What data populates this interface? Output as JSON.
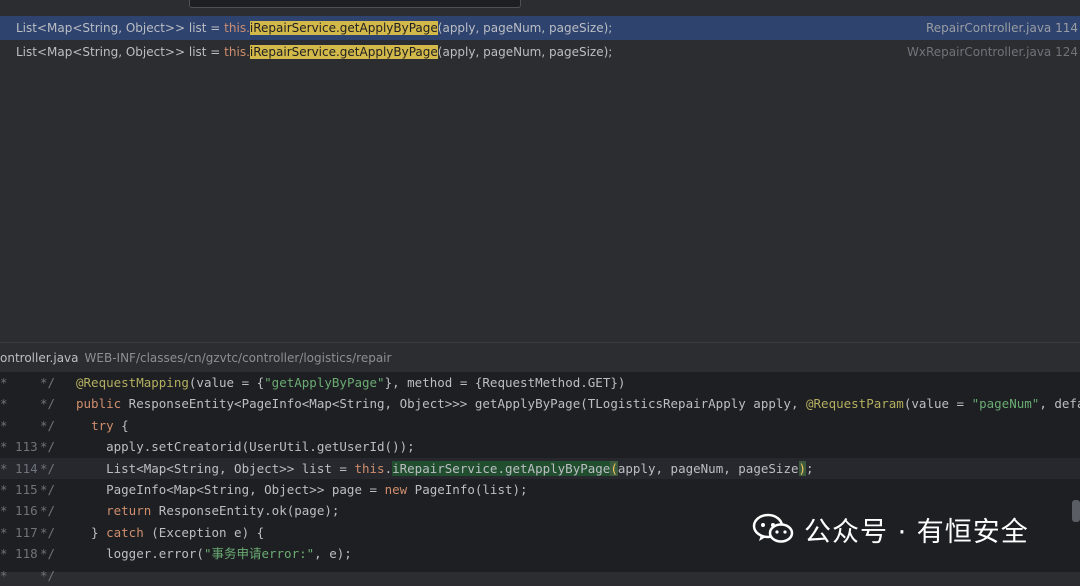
{
  "top": {
    "tabs": [
      "",
      "",
      ""
    ],
    "search_value": ""
  },
  "results": [
    {
      "prefix": "List<Map<String, Object>> list = ",
      "this": "this.",
      "match": "iRepairService.getApplyByPage",
      "suffix": "(apply, pageNum, pageSize);",
      "location": "RepairController.java 114",
      "selected": true
    },
    {
      "prefix": "List<Map<String, Object>> list = ",
      "this": "this.",
      "match": "iRepairService.getApplyByPage",
      "suffix": "(apply, pageNum, pageSize);",
      "location": "WxRepairController.java 124",
      "selected": false
    }
  ],
  "path": {
    "file": "ontroller.java",
    "dir": "WEB-INF/classes/cn/gzvtc/controller/logistics/repair"
  },
  "code": [
    {
      "ln": "*",
      "cm": "*/",
      "parts": [
        [
          "ann",
          "@RequestMapping"
        ],
        [
          "",
          "(value = {"
        ],
        [
          "str",
          "\"getApplyByPage\""
        ],
        [
          "",
          "}, method = {RequestMethod.GET})"
        ]
      ]
    },
    {
      "ln": "*",
      "cm": "*/",
      "parts": [
        [
          "kw",
          "public"
        ],
        [
          "",
          " ResponseEntity<PageInfo<Map<String, Object>>> getApplyByPage(TLogisticsRepairApply apply, "
        ],
        [
          "ann",
          "@RequestParam"
        ],
        [
          "",
          "(value = "
        ],
        [
          "str",
          "\"pageNum\""
        ],
        [
          "",
          ", defaultV"
        ]
      ]
    },
    {
      "ln": "*",
      "cm": "*/",
      "parts": [
        [
          "",
          "  "
        ],
        [
          "kw",
          "try"
        ],
        [
          "",
          " {"
        ]
      ]
    },
    {
      "ln": "* 113",
      "cm": "*/",
      "parts": [
        [
          "",
          "    apply.setCreatorid(UserUtil.getUserId());"
        ]
      ]
    },
    {
      "ln": "* 114",
      "cm": "*/",
      "current": true,
      "parts": [
        [
          "",
          "    List<Map<String, Object>> list = "
        ],
        [
          "kw",
          "this"
        ],
        [
          "",
          "."
        ],
        [
          "usage",
          "iRepairService.getApplyByPage"
        ],
        [
          "brace",
          "("
        ],
        [
          "",
          "apply, pageNum, pageSize"
        ],
        [
          "brace",
          ")"
        ],
        [
          "",
          ";"
        ]
      ]
    },
    {
      "ln": "* 115",
      "cm": "*/",
      "parts": [
        [
          "",
          "    PageInfo<Map<String, Object>> page = "
        ],
        [
          "kw",
          "new"
        ],
        [
          "",
          " PageInfo(list);"
        ]
      ]
    },
    {
      "ln": "* 116",
      "cm": "*/",
      "parts": [
        [
          "",
          "    "
        ],
        [
          "kw",
          "return"
        ],
        [
          "",
          " ResponseEntity.ok(page);"
        ]
      ]
    },
    {
      "ln": "* 117",
      "cm": "*/",
      "parts": [
        [
          "",
          "  } "
        ],
        [
          "kw",
          "catch"
        ],
        [
          "",
          " (Exception e) {"
        ]
      ]
    },
    {
      "ln": "* 118",
      "cm": "*/",
      "parts": [
        [
          "",
          "    logger.error("
        ],
        [
          "str",
          "\"事务申请error:\""
        ],
        [
          "",
          ", e);"
        ]
      ]
    },
    {
      "ln": "*",
      "cm": "*/",
      "parts": [
        [
          "",
          ""
        ]
      ]
    }
  ],
  "watermark": {
    "text": "公众号 · 有恒安全",
    "icon": "wechat-icon"
  }
}
